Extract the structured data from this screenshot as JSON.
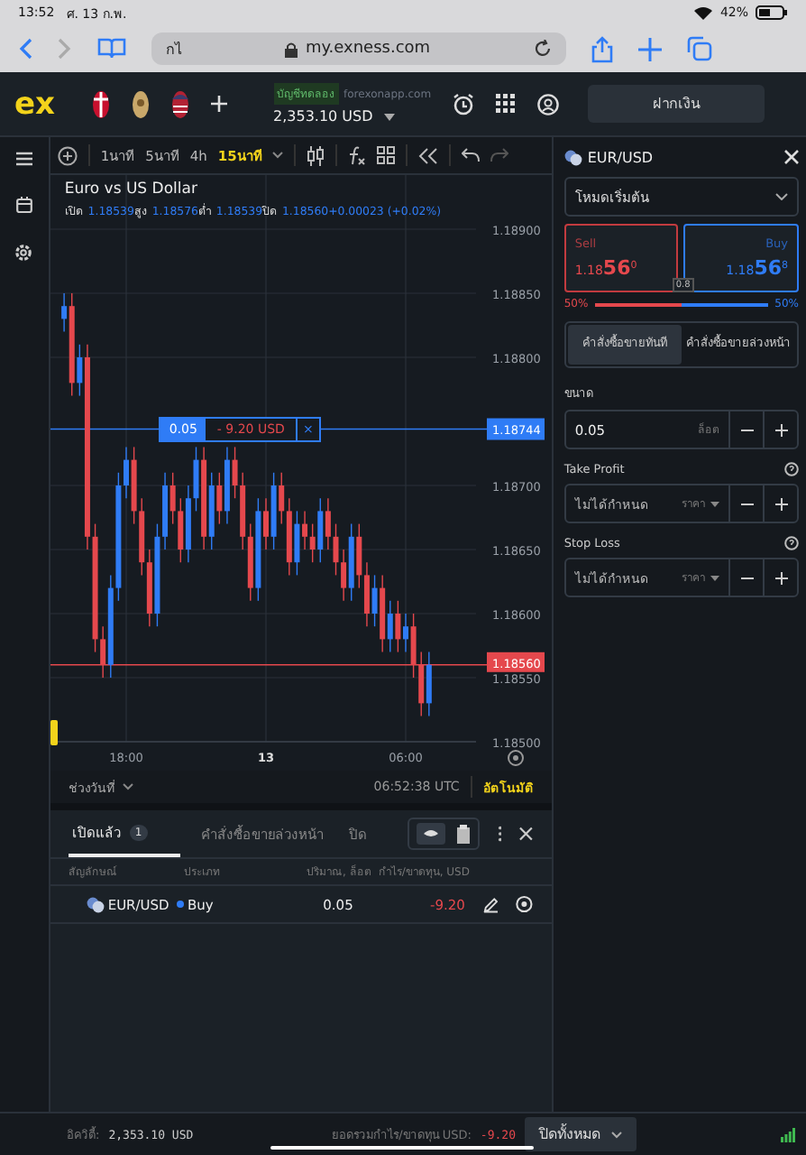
{
  "status_bar": {
    "time": "13:52",
    "date": "ศ. 13 ก.พ.",
    "battery": "42%"
  },
  "browser": {
    "tab_text": "กไ",
    "url": "my.exness.com"
  },
  "header": {
    "logo": "ex",
    "account_badge": "บัญชีทดลอง",
    "server": "forexonapp.com",
    "balance": "2,353.10 USD",
    "deposit_button": "ฝากเงิน"
  },
  "toolbar": {
    "timeframes": [
      {
        "label": "1นาที",
        "selected": false
      },
      {
        "label": "5นาที",
        "selected": false
      },
      {
        "label": "4h",
        "selected": false
      },
      {
        "label": "15นาที",
        "selected": true
      }
    ]
  },
  "chart": {
    "title": "Euro vs US Dollar",
    "ohlc": [
      {
        "label": "เปิด",
        "value": "1.18539"
      },
      {
        "label": "สูง",
        "value": "1.18576"
      },
      {
        "label": "ต่ำ",
        "value": "1.18539"
      },
      {
        "label": "ปิด",
        "value": "1.18560"
      }
    ],
    "change": "+0.00023 (+0.02%)",
    "chart_data": {
      "type": "candlestick",
      "ylim": [
        1.185,
        1.189
      ],
      "grid": true,
      "ref_lines": [
        {
          "axis": "y",
          "value": 1.18744,
          "label": "1.18744",
          "color": "#2f7cf6"
        },
        {
          "axis": "y",
          "value": 1.1856,
          "label": "1.18560",
          "color": "#e5484d"
        }
      ],
      "yticks": [
        {
          "value": 1.189,
          "label": "1.18900"
        },
        {
          "value": 1.1885,
          "label": "1.18850"
        },
        {
          "value": 1.188,
          "label": "1.18800"
        },
        {
          "value": 1.187,
          "label": "1.18700"
        },
        {
          "value": 1.1865,
          "label": "1.18650"
        },
        {
          "value": 1.186,
          "label": "1.18600"
        },
        {
          "value": 1.1855,
          "label": "1.18550"
        },
        {
          "value": 1.185,
          "label": "1.18500"
        }
      ],
      "categories": [
        null,
        null,
        null,
        null,
        null,
        null,
        null,
        null,
        "18:00",
        null,
        null,
        null,
        null,
        null,
        null,
        null,
        null,
        null,
        null,
        null,
        null,
        null,
        null,
        null,
        null,
        null,
        "13",
        null,
        null,
        null,
        null,
        null,
        null,
        null,
        null,
        null,
        null,
        null,
        null,
        null,
        null,
        null,
        null,
        null,
        "06:00",
        null,
        null,
        null
      ],
      "ohlc": [
        [
          1.1883,
          1.1885,
          1.1882,
          1.1884
        ],
        [
          1.1884,
          1.1885,
          1.1877,
          1.1878
        ],
        [
          1.1878,
          1.1881,
          1.1877,
          1.188
        ],
        [
          1.188,
          1.1881,
          1.1865,
          1.1866
        ],
        [
          1.1866,
          1.1867,
          1.1857,
          1.1858
        ],
        [
          1.1858,
          1.1859,
          1.1855,
          1.1856
        ],
        [
          1.1856,
          1.1863,
          1.1855,
          1.1862
        ],
        [
          1.1862,
          1.1871,
          1.1861,
          1.187
        ],
        [
          1.187,
          1.1873,
          1.1869,
          1.1872
        ],
        [
          1.1872,
          1.1873,
          1.1867,
          1.1868
        ],
        [
          1.1868,
          1.1869,
          1.1863,
          1.1864
        ],
        [
          1.1864,
          1.1865,
          1.1859,
          1.186
        ],
        [
          1.186,
          1.1867,
          1.1859,
          1.1866
        ],
        [
          1.1866,
          1.1871,
          1.1865,
          1.187
        ],
        [
          1.187,
          1.1871,
          1.1867,
          1.1868
        ],
        [
          1.1868,
          1.1869,
          1.1864,
          1.1865
        ],
        [
          1.1865,
          1.187,
          1.1864,
          1.1869
        ],
        [
          1.1869,
          1.1873,
          1.1868,
          1.1872
        ],
        [
          1.1872,
          1.1873,
          1.1865,
          1.1866
        ],
        [
          1.1866,
          1.1871,
          1.1865,
          1.187
        ],
        [
          1.187,
          1.1871,
          1.1867,
          1.1868
        ],
        [
          1.1868,
          1.1873,
          1.1867,
          1.1872
        ],
        [
          1.1872,
          1.1873,
          1.1869,
          1.187
        ],
        [
          1.187,
          1.1871,
          1.1865,
          1.1866
        ],
        [
          1.1866,
          1.1867,
          1.1861,
          1.1862
        ],
        [
          1.1862,
          1.1869,
          1.1861,
          1.1868
        ],
        [
          1.1868,
          1.1869,
          1.1865,
          1.1866
        ],
        [
          1.1866,
          1.1871,
          1.1865,
          1.187
        ],
        [
          1.187,
          1.1871,
          1.1867,
          1.1868
        ],
        [
          1.1868,
          1.1869,
          1.1863,
          1.1864
        ],
        [
          1.1864,
          1.1868,
          1.1863,
          1.1867
        ],
        [
          1.1867,
          1.1868,
          1.1865,
          1.1866
        ],
        [
          1.1866,
          1.1867,
          1.1864,
          1.1865
        ],
        [
          1.1865,
          1.1869,
          1.1864,
          1.1868
        ],
        [
          1.1868,
          1.1869,
          1.1865,
          1.1866
        ],
        [
          1.1866,
          1.1867,
          1.1863,
          1.1864
        ],
        [
          1.1864,
          1.1865,
          1.1861,
          1.1862
        ],
        [
          1.1862,
          1.1867,
          1.1861,
          1.1866
        ],
        [
          1.1866,
          1.1867,
          1.1862,
          1.1863
        ],
        [
          1.1863,
          1.1864,
          1.1859,
          1.186
        ],
        [
          1.186,
          1.1863,
          1.1859,
          1.1862
        ],
        [
          1.1862,
          1.1863,
          1.1857,
          1.1858
        ],
        [
          1.1858,
          1.1861,
          1.1857,
          1.186
        ],
        [
          1.186,
          1.1861,
          1.1857,
          1.1858
        ],
        [
          1.1858,
          1.186,
          1.1857,
          1.1859
        ],
        [
          1.1859,
          1.186,
          1.1855,
          1.1856
        ],
        [
          1.1856,
          1.1857,
          1.1852,
          1.1853
        ],
        [
          1.1853,
          1.1857,
          1.1852,
          1.1856
        ]
      ]
    },
    "position": {
      "volume": "0.05",
      "profit": "- 9.20 USD",
      "close": "×"
    },
    "range_button": "ช่วงวันที่",
    "clock": "06:52:38 UTC",
    "auto_button": "อัตโนมัติ"
  },
  "order_panel": {
    "symbol": "EUR/USD",
    "mode": "โหมดเริ่มต้น",
    "sell": {
      "label": "Sell",
      "price": "1.18**56**$^{0}$"
    },
    "buy": {
      "label": "Buy",
      "price": "1.18**56**$^{8}$"
    },
    "spread": "0.8",
    "sell_share": "50%",
    "buy_share": "50%",
    "level": 0.5,
    "order_types": [
      {
        "label": "คำสั่งซื้อขายทันที",
        "selected": true
      },
      {
        "label": "คำสั่งซื้อขายล่วงหน้า",
        "selected": false
      }
    ],
    "fields": [
      {
        "kind": "volume",
        "label": "ขนาด",
        "value": "0.05",
        "unit": "ล็อต"
      },
      {
        "kind": "price",
        "label": "Take Profit",
        "placeholder": "ไม่ได้กำหนด",
        "unit": "ราคา"
      },
      {
        "kind": "price",
        "label": "Stop Loss",
        "placeholder": "ไม่ได้กำหนด",
        "unit": "ราคา"
      }
    ]
  },
  "bottom_panel": {
    "tabs": [
      {
        "label": "เปิดแล้ว",
        "count": "1",
        "selected": true
      },
      {
        "label": "คำสั่งซื้อขายล่วงหน้า",
        "selected": false
      },
      {
        "label": "ปิด",
        "selected": false
      }
    ],
    "columns": [
      "สัญลักษณ์",
      "ประเภท",
      "ปริมาณ, ล็อต",
      "กำไร/ขาดทุน, USD"
    ],
    "rows": [
      {
        "symbol": "EUR/USD",
        "type": "Buy",
        "volume": "0.05",
        "profit": "-9.20"
      }
    ]
  },
  "footer": {
    "equity_label": "อิควิตี้:",
    "equity": "2,353.10 USD",
    "pl_label": "ยอดรวมกำไร/ขาดทุน USD:",
    "pl": "-9.20",
    "close_all": "ปิดทั้งหมด"
  }
}
